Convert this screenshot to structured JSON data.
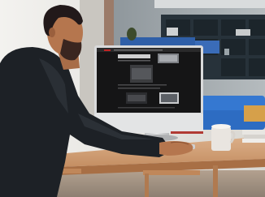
{
  "photo": {
    "colors": {
      "wall_left": "#e9e8e4",
      "wall_right": "#a7aeb2",
      "shelf": "#27323a",
      "sofa": "#2f6fc4",
      "desk": "#d2a279",
      "desk_edge": "#a86f45",
      "jacket": "#1d2126",
      "skin": "#b5764e",
      "hair": "#22191a",
      "monitor_body": "#d9dadb",
      "monitor_screen": "#151516",
      "mug": "#e9e5e0"
    }
  }
}
